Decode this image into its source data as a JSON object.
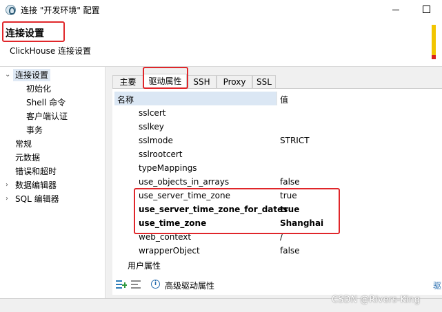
{
  "window": {
    "title": "连接 \"开发环境\" 配置"
  },
  "header": {
    "title": "连接设置",
    "subtitle": "ClickHouse 连接设置"
  },
  "sidebar": {
    "items": [
      {
        "label": "连接设置",
        "expanded": true
      },
      {
        "label": "初始化"
      },
      {
        "label": "Shell 命令"
      },
      {
        "label": "客户端认证"
      },
      {
        "label": "事务"
      },
      {
        "label": "常规"
      },
      {
        "label": "元数据"
      },
      {
        "label": "错误和超时"
      },
      {
        "label": "数据编辑器",
        "expanded": false
      },
      {
        "label": "SQL 编辑器",
        "expanded": false
      }
    ]
  },
  "tabs": [
    {
      "label": "主要"
    },
    {
      "label": "驱动属性",
      "active": true
    },
    {
      "label": "SSH"
    },
    {
      "label": "Proxy"
    },
    {
      "label": "SSL"
    }
  ],
  "table": {
    "headers": {
      "name": "名称",
      "value": "值"
    },
    "rows": [
      {
        "key": "sslcert",
        "value": ""
      },
      {
        "key": "sslkey",
        "value": ""
      },
      {
        "key": "sslmode",
        "value": "STRICT"
      },
      {
        "key": "sslrootcert",
        "value": ""
      },
      {
        "key": "typeMappings",
        "value": ""
      },
      {
        "key": "use_objects_in_arrays",
        "value": "false"
      },
      {
        "key": "use_server_time_zone",
        "value": "true"
      },
      {
        "key": "use_server_time_zone_for_dates",
        "value": "true"
      },
      {
        "key": "use_time_zone",
        "value": "Shanghai"
      },
      {
        "key": "web_context",
        "value": "/"
      },
      {
        "key": "wrapperObject",
        "value": "false"
      }
    ],
    "user_properties": "用户属性"
  },
  "bottom": {
    "icons": [
      "add-property-icon",
      "list-icon",
      "info-icon"
    ],
    "advanced_label": "高级驱动属性",
    "right_link": "驱"
  },
  "watermark": "CSDN @Rivers-King",
  "colors": {
    "highlight": "#e0262a",
    "selection": "#dfe9f5",
    "accent": "#2a6fb0"
  }
}
